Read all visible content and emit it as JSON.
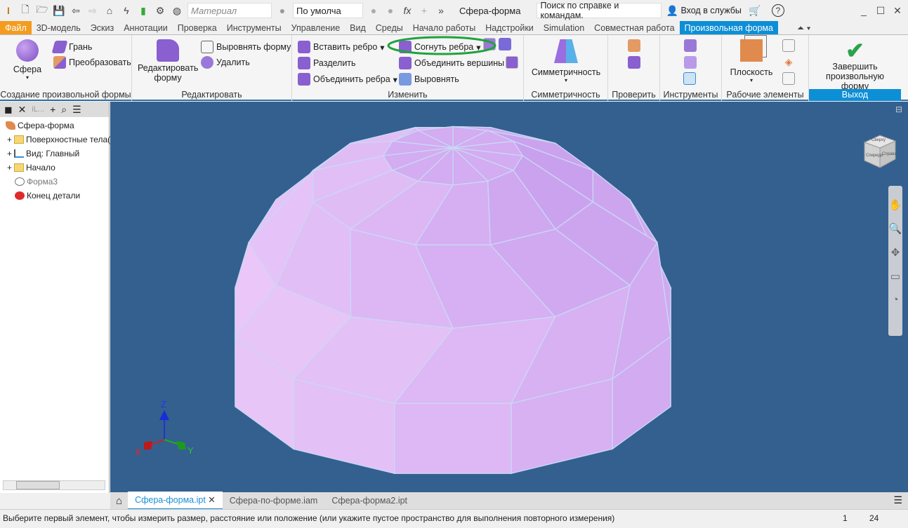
{
  "titlebar": {
    "material_placeholder": "Материал",
    "appearance": "По умолча",
    "title": "Сфера-форма",
    "search_placeholder": "Поиск по справке и командам.",
    "signin": "Вход в службы",
    "help": "?"
  },
  "tabs": [
    "Файл",
    "3D-модель",
    "Эскиз",
    "Аннотации",
    "Проверка",
    "Инструменты",
    "Управление",
    "Вид",
    "Среды",
    "Начало работы",
    "Надстройки",
    "Simulation",
    "Совместная работа",
    "Произвольная форма"
  ],
  "active_tab": "Произвольная форма",
  "ribbon": {
    "create": {
      "title": "Создание произвольной формы",
      "sphere": "Сфера",
      "face": "Грань",
      "convert": "Преобразовать"
    },
    "edit": {
      "title": "Редактировать",
      "edit_form": "Редактировать форму",
      "align_form": "Выровнять форму",
      "delete": "Удалить"
    },
    "modify": {
      "title": "Изменить",
      "insert_edge": "Вставить ребро",
      "split": "Разделить",
      "merge_edges": "Объединить ребра",
      "crease_edges": "Согнуть ребра",
      "weld_vertices": "Объединить вершины",
      "flatten": "Выровнять"
    },
    "symmetry": {
      "title": "Симметричность",
      "button": "Симметричность"
    },
    "check": {
      "title": "Проверить"
    },
    "tools": {
      "title": "Инструменты"
    },
    "work": {
      "title": "Рабочие элементы",
      "plane": "Плоскость"
    },
    "exit": {
      "title": "Выход",
      "finish": "Завершить произвольную форму"
    }
  },
  "browser": {
    "tab": "iL...",
    "items": [
      {
        "label": "Сфера-форма",
        "icon": "part-icon"
      },
      {
        "label": "Поверхностные тела(",
        "icon": "folder-icon"
      },
      {
        "label": "Вид: Главный",
        "icon": "view-icon"
      },
      {
        "label": "Начало",
        "icon": "folder-icon"
      },
      {
        "label": "Форма3",
        "icon": "freeform-icon"
      },
      {
        "label": "Конец детали",
        "icon": "end-of-part-icon"
      }
    ]
  },
  "viewport": {
    "background": "#33608f",
    "shape_color": "#d7a8f5",
    "axes": {
      "x": "X",
      "y": "Y",
      "z": "Z"
    },
    "viewcube": {
      "top": "Сверху",
      "front": "Спереди",
      "right": "Справа"
    }
  },
  "doc_tabs": [
    {
      "label": "Сфера-форма.ipt",
      "active": true
    },
    {
      "label": "Сфера-по-форме.iam"
    },
    {
      "label": "Сфера-форма2.ipt"
    }
  ],
  "status": {
    "message": "Выберите первый элемент, чтобы измерить размер, расстояние или положение (или укажите пустое пространство для выполнения повторного измерения)",
    "field1": "1",
    "field2": "24"
  }
}
